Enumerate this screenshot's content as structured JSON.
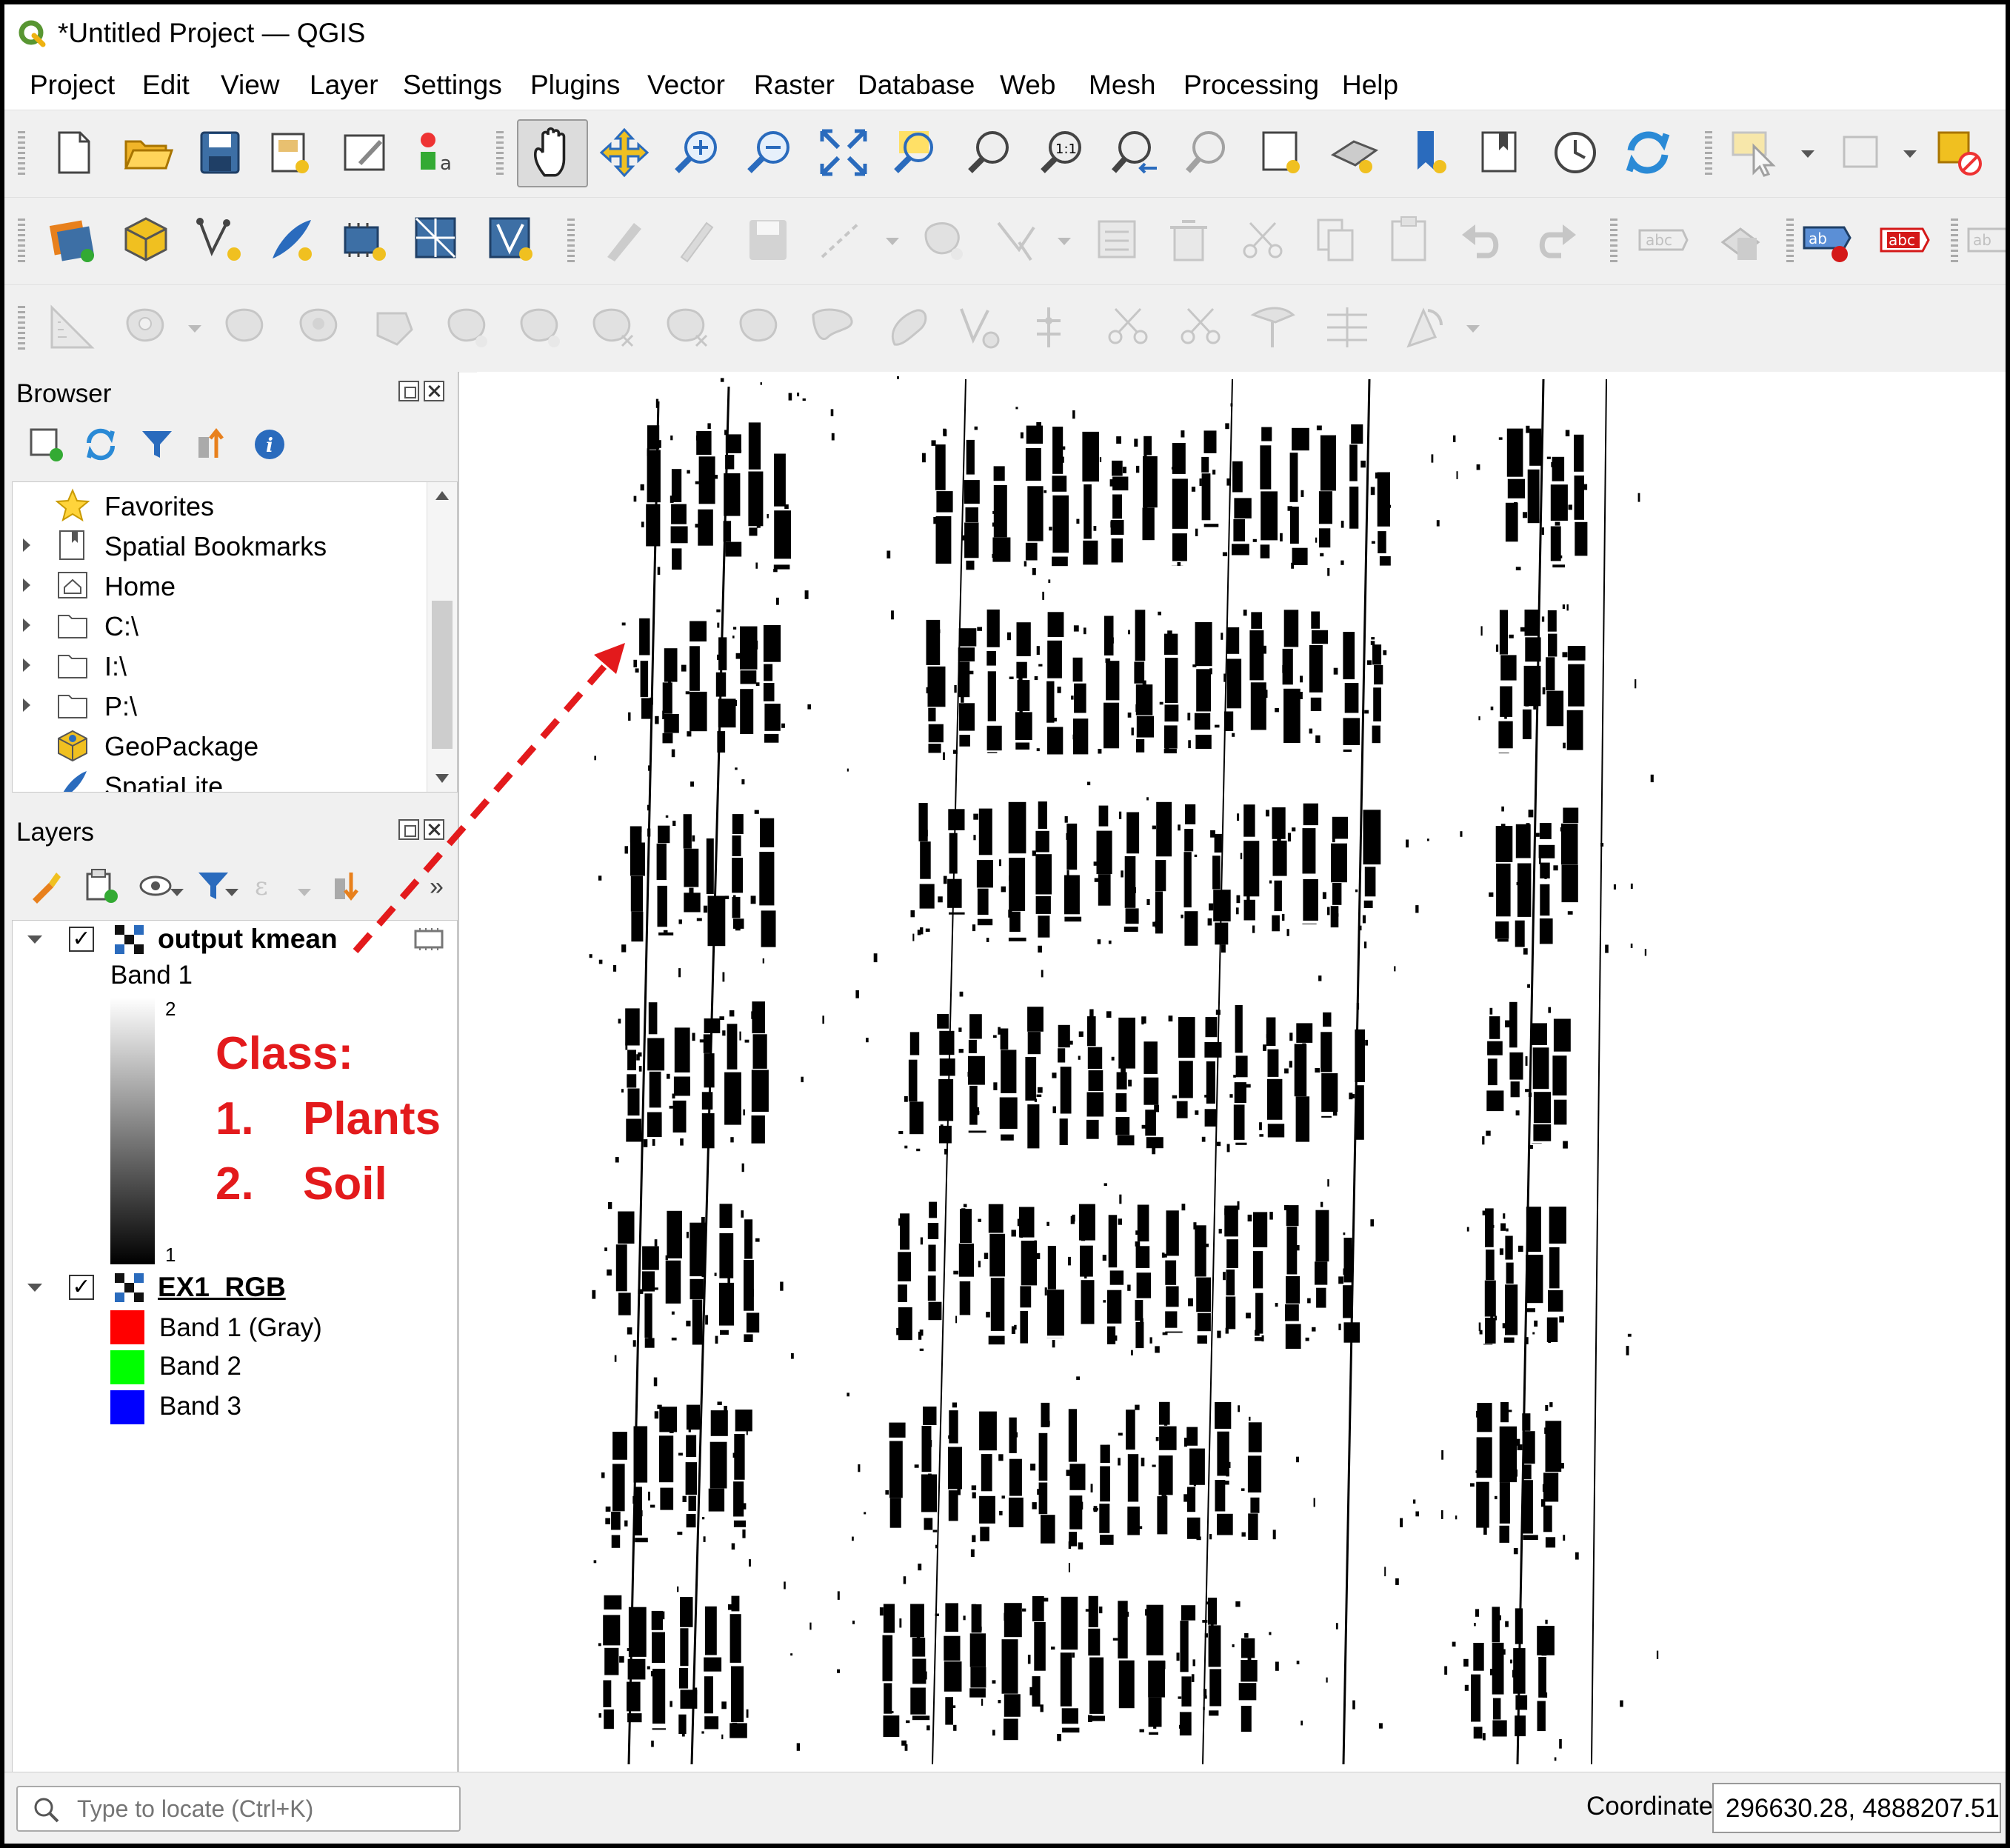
{
  "window": {
    "title": "*Untitled Project — QGIS"
  },
  "menu": [
    {
      "label": "Project"
    },
    {
      "label": "Edit"
    },
    {
      "label": "View"
    },
    {
      "label": "Layer"
    },
    {
      "label": "Settings"
    },
    {
      "label": "Plugins"
    },
    {
      "label": "Vector"
    },
    {
      "label": "Raster"
    },
    {
      "label": "Database"
    },
    {
      "label": "Web"
    },
    {
      "label": "Mesh"
    },
    {
      "label": "Processing"
    },
    {
      "label": "Help"
    }
  ],
  "toolbar": {
    "row1": [
      "new-project",
      "open-project",
      "save-project",
      "new-print-layout",
      "layout-manager",
      "style-manager",
      "pan-map",
      "pan-to-selection",
      "zoom-in",
      "zoom-out",
      "zoom-full",
      "zoom-to-selection",
      "zoom-to-layer",
      "zoom-native",
      "zoom-last",
      "zoom-next",
      "new-map-view",
      "new-3d-map-view",
      "new-spatial-bookmark",
      "show-bookmarks",
      "temporal-controller",
      "refresh",
      "select-features",
      "deselect-all",
      "identify"
    ],
    "row2": [
      "data-source-manager",
      "new-geopackage-layer",
      "new-shapefile-layer",
      "new-spatialite-layer",
      "new-virtual-layer",
      "new-mesh-layer",
      "current-edits",
      "toggle-editing",
      "save-edits",
      "digitize",
      "add-feature",
      "vertex-tool",
      "modify-attributes",
      "delete-selected",
      "cut-features",
      "copy-features",
      "paste-features",
      "undo",
      "redo",
      "label-toolbar",
      "layer-diagram",
      "label-pin",
      "label-show-hide"
    ],
    "row3": [
      "advanced-digitizing",
      "add-ring",
      "add-part",
      "fill-ring",
      "delete-ring",
      "delete-part",
      "reshape",
      "offset-curve",
      "reverse-line",
      "simplify",
      "split-features",
      "split-parts",
      "merge-features",
      "merge-attributes",
      "rotate-point-symbols",
      "offset-point-symbols",
      "trim-extend"
    ]
  },
  "browser": {
    "title": "Browser",
    "items": [
      {
        "label": "Favorites",
        "icon": "star-icon",
        "expandable": false
      },
      {
        "label": "Spatial Bookmarks",
        "icon": "bookmark-icon",
        "expandable": true
      },
      {
        "label": "Home",
        "icon": "home-folder-icon",
        "expandable": true
      },
      {
        "label": "C:\\",
        "icon": "folder-icon",
        "expandable": true
      },
      {
        "label": "I:\\",
        "icon": "folder-icon",
        "expandable": true
      },
      {
        "label": "P:\\",
        "icon": "folder-icon",
        "expandable": true
      },
      {
        "label": "GeoPackage",
        "icon": "geopackage-icon",
        "expandable": false
      },
      {
        "label": "SpatiaLite",
        "icon": "spatialite-icon",
        "expandable": false
      }
    ]
  },
  "layers": {
    "title": "Layers",
    "items": [
      {
        "name": "output kmean",
        "checked": "✓",
        "band_label": "Band 1",
        "ramp_max": "2",
        "ramp_min": "1"
      },
      {
        "name": "EX1_RGB",
        "checked": "✓",
        "bands": [
          {
            "label": "Band 1 (Gray)",
            "color": "#ff0000"
          },
          {
            "label": "Band 2",
            "color": "#00ff00"
          },
          {
            "label": "Band 3",
            "color": "#0000ff"
          }
        ]
      }
    ]
  },
  "annotation": {
    "heading": "Class:",
    "items": [
      {
        "num": "1.",
        "label": "Plants"
      },
      {
        "num": "2.",
        "label": "Soil"
      }
    ],
    "color": "#e31a1c"
  },
  "statusbar": {
    "locator_placeholder": "Type to locate (Ctrl+K)",
    "coordinate_label": "Coordinate",
    "coordinate_value": "296630.28, 4888207.51"
  },
  "map": {
    "description_layer": "output kmean",
    "classes": {
      "plants_color": "#000000",
      "soil_color": "#ffffff"
    }
  }
}
